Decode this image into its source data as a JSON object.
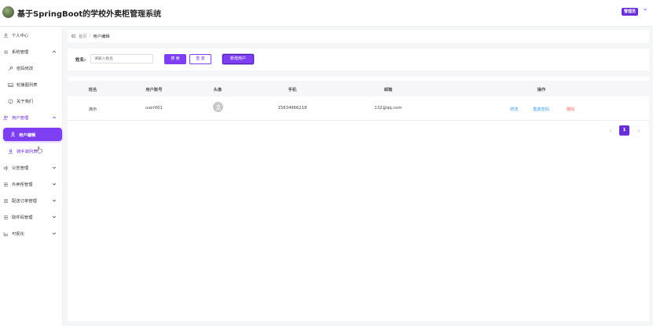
{
  "header": {
    "title": "基于SpringBoot的学校外卖柜管理系统",
    "subtitle": "用户编辑",
    "admin_label": "管理员"
  },
  "sidebar": {
    "items": [
      {
        "label": "个人中心",
        "icon": "user-icon"
      },
      {
        "label": "系统管理",
        "icon": "gear-icon",
        "expanded": true
      },
      {
        "label": "密码修改",
        "icon": "key-icon"
      },
      {
        "label": "轮播图列表",
        "icon": "image-icon"
      },
      {
        "label": "关于我们",
        "icon": "info-icon"
      },
      {
        "label": "用户管理",
        "icon": "users-icon",
        "expanded": true
      },
      {
        "label": "用户编辑",
        "icon": "user-icon",
        "active": true
      },
      {
        "label": "骑手端列表",
        "icon": "user-icon"
      },
      {
        "label": "公告管理",
        "icon": "speaker-icon"
      },
      {
        "label": "外卖柜管理",
        "icon": "list-icon"
      },
      {
        "label": "配送订单管理",
        "icon": "list-icon"
      },
      {
        "label": "取件码管理",
        "icon": "list-icon"
      },
      {
        "label": "可视化",
        "icon": "chart-icon"
      }
    ]
  },
  "breadcrumb": {
    "home": "首页",
    "separator": "/",
    "current": "用户编辑"
  },
  "search": {
    "name_label": "姓名:",
    "name_placeholder": "请输入姓名",
    "search_button": "搜 索",
    "reset_button": "重 置",
    "add_button": "新增用户"
  },
  "table": {
    "columns": [
      "姓名",
      "用户账号",
      "头像",
      "手机",
      "邮箱",
      "操作"
    ],
    "rows": [
      {
        "name": "演示",
        "account": "user001",
        "phone": "15634966218",
        "email": "132@qq.com",
        "actions": {
          "edit": "修改",
          "reset_password": "重置密码",
          "delete": "删除"
        }
      }
    ]
  },
  "pagination": {
    "current_page": "1"
  },
  "colors": {
    "accent": "#7e3ff2",
    "link": "#409eff",
    "danger": "#f56c6c"
  }
}
